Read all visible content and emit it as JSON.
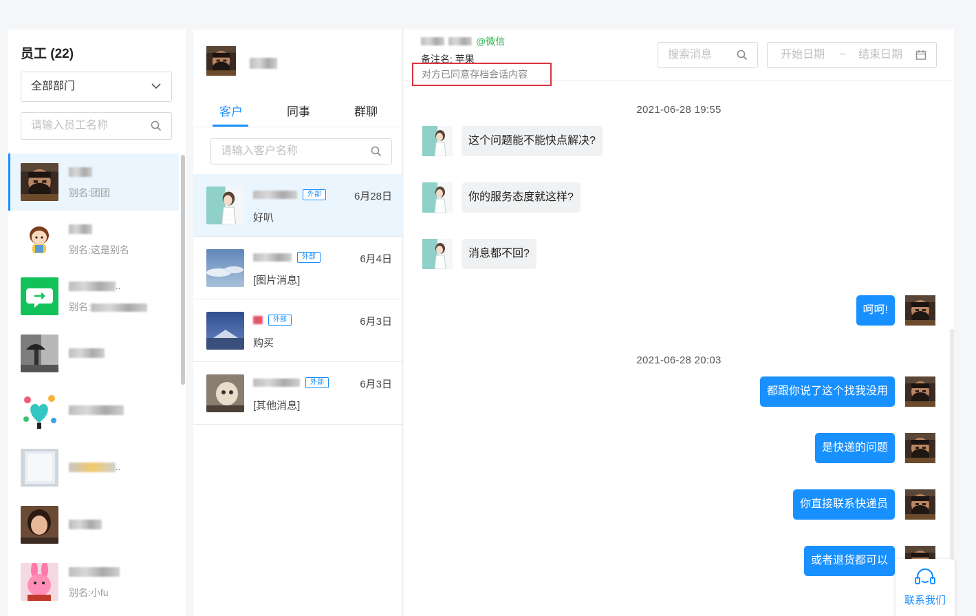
{
  "employees": {
    "title": "员工 (22)",
    "department_select": "全部部门",
    "search_placeholder": "请输入员工名称",
    "items": [
      {
        "alias": "别名:团团",
        "active": true
      },
      {
        "alias": "别名:这是别名"
      },
      {
        "alias": "别名:",
        "name_suffix": ".."
      },
      {
        "alias": ""
      },
      {
        "alias": ""
      },
      {
        "alias": "",
        "name_suffix": ".."
      },
      {
        "alias": ""
      },
      {
        "alias": "别名:小fu"
      }
    ]
  },
  "customers": {
    "tabs": [
      "客户",
      "同事",
      "群聊"
    ],
    "active_tab": "客户",
    "search_placeholder": "请输入客户名称",
    "external_badge": "外部",
    "conversations": [
      {
        "date": "6月28日",
        "last_message": "好叭",
        "active": true
      },
      {
        "date": "6月4日",
        "last_message": "[图片消息]"
      },
      {
        "date": "6月3日",
        "last_message": "购买"
      },
      {
        "date": "6月3日",
        "last_message": "[其他消息]"
      }
    ]
  },
  "chat": {
    "wechat_tag": "@微信",
    "remark": "备注名: 苹果",
    "consent": "对方已同意存档会话内容",
    "search_placeholder": "搜索消息",
    "date_start_placeholder": "开始日期",
    "date_separator": "~",
    "date_end_placeholder": "结束日期",
    "timestamps": [
      "2021-06-28 19:55",
      "2021-06-28 20:03"
    ],
    "messages": [
      {
        "dir": "in",
        "text": "这个问题能不能快点解决?"
      },
      {
        "dir": "in",
        "text": "你的服务态度就这样?"
      },
      {
        "dir": "in",
        "text": "消息都不回?"
      },
      {
        "dir": "out",
        "text": "呵呵!"
      },
      {
        "dir": "out",
        "text": "都跟你说了这个找我没用"
      },
      {
        "dir": "out",
        "text": "是快递的问题"
      },
      {
        "dir": "out",
        "text": "你直接联系快递员"
      },
      {
        "dir": "out",
        "text": "或者退货都可以"
      }
    ]
  },
  "contact_us": {
    "label": "联系我们"
  },
  "colors": {
    "accent": "#1890ff",
    "wechat": "#2bb24c",
    "highlight_border": "#d9363e"
  }
}
